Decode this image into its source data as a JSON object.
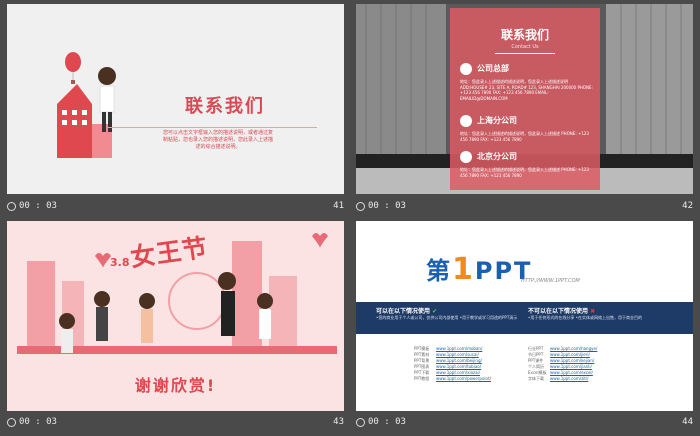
{
  "slides": [
    {
      "number": "41",
      "time": "00 : 03"
    },
    {
      "number": "42",
      "time": "00 : 03"
    },
    {
      "number": "43",
      "time": "00 : 03"
    },
    {
      "number": "44",
      "time": "00 : 03"
    }
  ],
  "slide1": {
    "title": "联系我们",
    "body": "您可以点击文字框输入您的描述说明，或者通过复制粘贴，您也录入您的描述说明，您此录入上述描述的综合描述说明。"
  },
  "slide2": {
    "title": "联系我们",
    "subtitle": "Contact Us",
    "sections": [
      {
        "heading": "公司总部",
        "detail": "地址：您此录入上述描述的描述说明，您此录入上述描述说明 ADD:HOUSE# 23, SITE A, ROAD# 123, SHANGHAI 200000 PHONE: +123 456 7890 FAX: +123 456 7890 EMAIL: EMAILID@DOMAIN.COM"
      },
      {
        "heading": "上海分公司",
        "detail": "地址：您此录入上述描述的描述说明，您此录入上述描述 PHONE: +123 456 7890  FAX: +123 456 7890"
      },
      {
        "heading": "北京分公司",
        "detail": "地址：您此录入上述描述的描述说明，您此录入上述描述 PHONE: +123 456 7890  FAX: +123 456 7890"
      }
    ]
  },
  "slide3": {
    "festival_number": "3.8",
    "festival": "女王节",
    "thanks": "谢谢欣赏!"
  },
  "slide4": {
    "logo_prefix": "第",
    "logo_one": "1",
    "logo_suffix": "PPT",
    "url": "HTTP://WWW.1PPT.COM",
    "can_use_title": "可以在以下情况使用",
    "can_use_detail": "•您的商业用于个人或公司，仅供公司内部使用 •用于教学或学习用途的PPT演示",
    "cannot_use_title": "不可以在以下情况使用",
    "cannot_use_detail": "•用于任何形式的在线分享 •在实体或网络上出售，用于商业目的",
    "links": [
      {
        "label": "PPT模板",
        "value": "www.1ppt.com/moban/"
      },
      {
        "label": "PPT素材",
        "value": "www.1ppt.com/sucai/"
      },
      {
        "label": "PPT背景",
        "value": "www.1ppt.com/beijing/"
      },
      {
        "label": "PPT图表",
        "value": "www.1ppt.com/tubiao/"
      },
      {
        "label": "PPT下载",
        "value": "www.1ppt.com/xiazai/"
      },
      {
        "label": "PPT教程",
        "value": "www.1ppt.com/powerpoint/"
      }
    ],
    "links2": [
      {
        "label": "行业PPT",
        "value": "www.1ppt.com/hangye/"
      },
      {
        "label": "节日PPT",
        "value": "www.1ppt.com/jieri/"
      },
      {
        "label": "PPT课件",
        "value": "www.1ppt.com/kejian/"
      },
      {
        "label": "个人简历",
        "value": "www.1ppt.com/jianli/"
      },
      {
        "label": "Excel模板",
        "value": "www.1ppt.com/excel/"
      },
      {
        "label": "字体下载",
        "value": "www.1ppt.com/ziti/"
      }
    ]
  },
  "colors": {
    "accent": "#d94a55",
    "brand_blue": "#1a5fb0",
    "band": "#1e3a66"
  }
}
